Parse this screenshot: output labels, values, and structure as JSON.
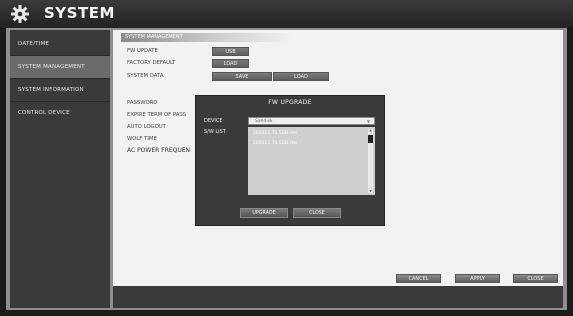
{
  "header": {
    "title": "SYSTEM",
    "icon": "gear-icon"
  },
  "sidebar": {
    "items": [
      {
        "label": "DATE/TIME",
        "selected": false
      },
      {
        "label": "SYSTEM MANAGEMENT",
        "selected": true
      },
      {
        "label": "SYSTEM INFORMATION",
        "selected": false
      },
      {
        "label": "CONTROL DEVICE",
        "selected": false
      }
    ]
  },
  "main": {
    "section_title": "SYSTEM MANAGEMENT",
    "rows": {
      "fw_update": {
        "label": "FW UPDATE",
        "button": "USB"
      },
      "factory_default": {
        "label": "FACTORY DEFAULT",
        "button": "LOAD"
      },
      "system_data": {
        "label": "SYSTEM DATA",
        "save": "SAVE",
        "load": "LOAD"
      },
      "password": {
        "label": "PASSWORD"
      },
      "expire": {
        "label": "EXPIRE TERM OF PASS"
      },
      "auto_logout": {
        "label": "AUTO LOGOUT"
      },
      "wolf_time": {
        "label": "WOLF TIME"
      },
      "ac_power": {
        "label": "AC POWER FREQUEN"
      }
    }
  },
  "dialog": {
    "title": "FW UPGRADE",
    "device_label": "DEVICE",
    "device_value": "Sandisk",
    "sw_list_label": "S/W LIST",
    "files": [
      "205011.71.SDB.rbe",
      "205011.74.SDB.rbe"
    ],
    "upgrade_button": "UPGRADE",
    "close_button": "CLOSE"
  },
  "footer": {
    "cancel": "CANCEL",
    "apply": "APPLY",
    "close": "CLOSE"
  }
}
